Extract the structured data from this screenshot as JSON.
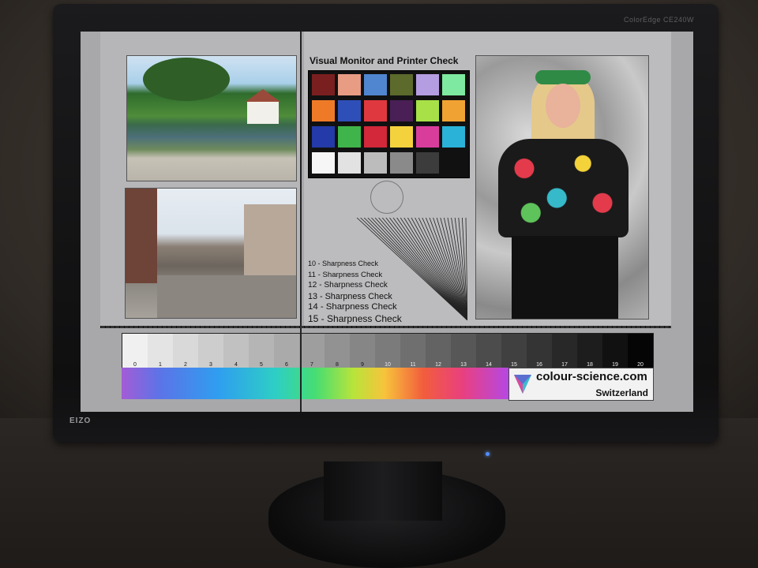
{
  "monitor": {
    "model_label": "ColorEdge CE240W",
    "brand_label": "EIZO",
    "screen_bg": "#a8a8ab",
    "led_color": "#4f8cff"
  },
  "test_chart": {
    "title": "Visual Monitor and Printer Check",
    "color_patches": [
      "#7a1f1f",
      "#e89c83",
      "#4f86cf",
      "#5c6a2c",
      "#b49de0",
      "#7ee9a0",
      "#ee7a28",
      "#2f4fb8",
      "#e0383f",
      "#4a1f55",
      "#a7e047",
      "#f0a232",
      "#233aa8",
      "#3fb44b",
      "#d2283a",
      "#f4d23e",
      "#d93d9c",
      "#2bb2d8",
      "#f6f6f6",
      "#e2e2e2",
      "#bcbcbc",
      "#8a8a8a",
      "#3c3c3c",
      "#111111"
    ],
    "sharpness_lines": [
      "10 - Sharpness Check",
      "11 - Sharpness Check",
      "12 - Sharpness Check",
      "13 - Sharpness Check",
      "14 - Sharpness Check",
      "15 - Sharpness Check"
    ],
    "grayscale_labels": [
      "0",
      "1",
      "2",
      "3",
      "4",
      "5",
      "6",
      "7",
      "8",
      "9",
      "10",
      "11",
      "12",
      "13",
      "14",
      "15",
      "16",
      "17",
      "18",
      "19",
      "20"
    ],
    "logo_text": "colour-science.com",
    "logo_subtext": "Switzerland"
  },
  "photos": {
    "landscape": "pond-house-photo",
    "street": "town-street-photo",
    "portrait": "woman-portrait-photo"
  }
}
